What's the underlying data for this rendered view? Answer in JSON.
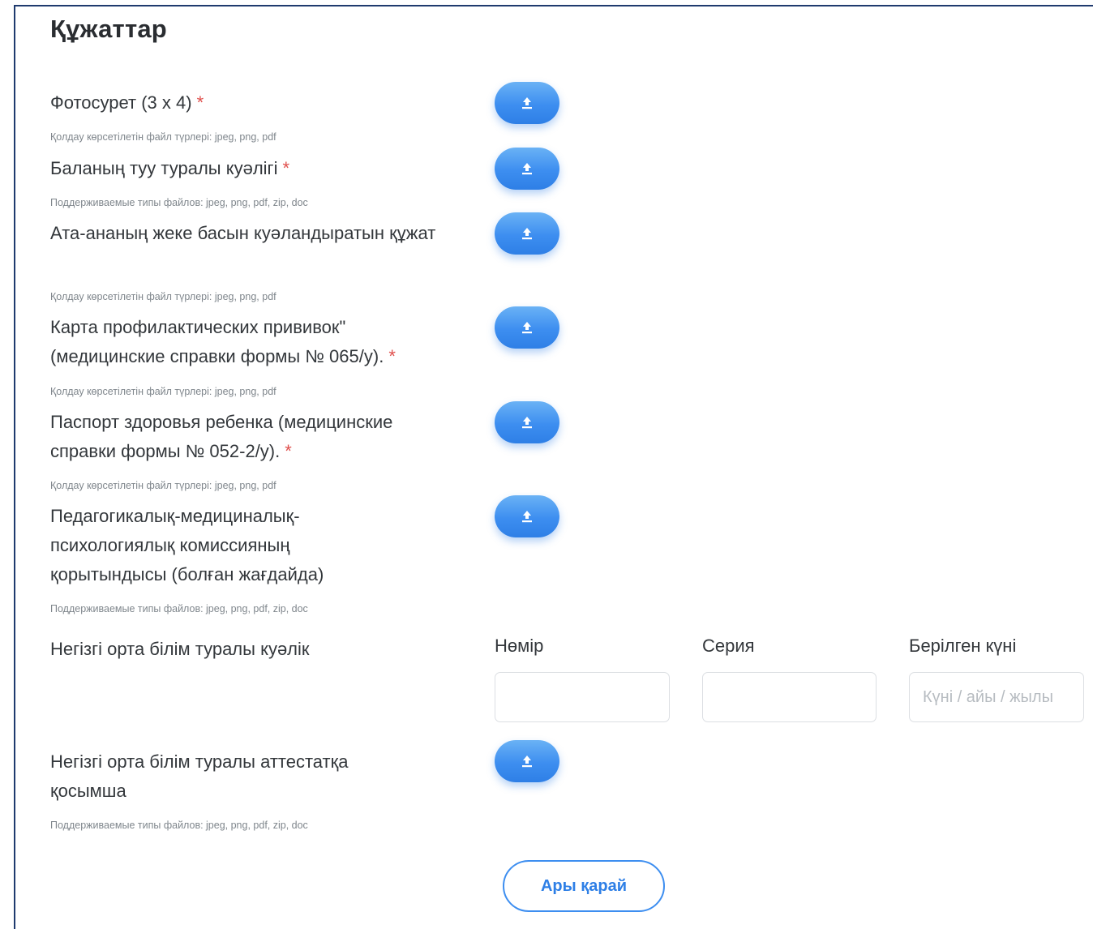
{
  "page": {
    "title": "Құжаттар"
  },
  "documents": [
    {
      "label": "Фотосурет (3 x 4)",
      "required_mark": "*",
      "hint": "Қолдау көрсетілетін файл түрлері: jpeg, png, pdf",
      "icon": "upload-icon"
    },
    {
      "label": "Баланың туу туралы куәлігі",
      "required_mark": "*",
      "hint": "Поддерживаемые типы файлов: jpeg, png, pdf, zip, doc",
      "icon": "upload-icon"
    },
    {
      "label": "Ата-ананың жеке басын куәландыратын құжат",
      "required_mark": "",
      "hint": "Қолдау көрсетілетін файл түрлері: jpeg, png, pdf",
      "icon": "upload-icon"
    },
    {
      "label": "Карта профилактических прививок\" (медицинские справки формы № 065/у).",
      "required_mark": "*",
      "hint": "Қолдау көрсетілетін файл түрлері: jpeg, png, pdf",
      "icon": "upload-icon"
    },
    {
      "label": "Паспорт здоровья ребенка (медицинские справки формы № 052-2/у).",
      "required_mark": "*",
      "hint": "Қолдау көрсетілетін файл түрлері: jpeg, png, pdf",
      "icon": "upload-icon"
    },
    {
      "label": "Педагогикалық-медициналық-психологиялық комиссияның қорытындысы (болған жағдайда)",
      "required_mark": "",
      "hint": "Поддерживаемые типы файлов: jpeg, png, pdf, zip, doc",
      "icon": "upload-icon"
    }
  ],
  "certificate": {
    "label": "Негізгі орта білім туралы куәлік",
    "number_label": "Нөмір",
    "number_value": "",
    "series_label": "Серия",
    "series_value": "",
    "date_label": "Берілген күні",
    "date_placeholder": "Күні / айы / жылы"
  },
  "attachment": {
    "label": "Негізгі орта білім туралы аттестатқа қосымша",
    "hint": "Поддерживаемые типы файлов: jpeg, png, pdf, zip, doc",
    "icon": "upload-icon"
  },
  "actions": {
    "next_label": "Ары қарай"
  },
  "colors": {
    "accent": "#3d8ef0",
    "required": "#e0504d",
    "frame": "#1f3a6e"
  }
}
